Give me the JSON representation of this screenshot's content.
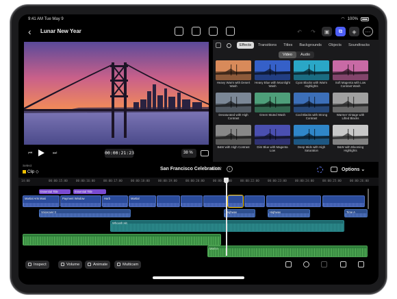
{
  "status": {
    "time": "9:41 AM",
    "date": "Tue May 9",
    "battery": "100%"
  },
  "header": {
    "back_icon": "chevron-left-icon",
    "title": "Lunar New Year"
  },
  "viewer": {
    "timecode": "00:00:21:23",
    "zoom": "38"
  },
  "browser": {
    "tabs": [
      "Effects",
      "Transitions",
      "Titles",
      "Backgrounds",
      "Objects",
      "Soundtracks"
    ],
    "active_tab": "Effects",
    "segments": [
      "Video",
      "Audio"
    ],
    "active_segment": "Video",
    "effects": [
      {
        "name": "Heavy Warm with Desert Wash",
        "tint": "#d88a5a"
      },
      {
        "name": "Heavy Blue with Moonlight Wash",
        "tint": "#3560c8"
      },
      {
        "name": "Cyan Blacks with Warm Highlights",
        "tint": "#2aa7c7"
      },
      {
        "name": "Soft Magenta with Low Contrast Wash",
        "tint": "#c86aa5"
      },
      {
        "name": "Desaturated with High Contrast",
        "tint": "#7b8796"
      },
      {
        "name": "Green Muted Wash",
        "tint": "#4e9f7a"
      },
      {
        "name": "Cool Blacks with Strong Contrast",
        "tint": "#3c6fb8"
      },
      {
        "name": "Warmer Vintage with Lifted Blacks",
        "tint": "#a0a0a0"
      },
      {
        "name": "B&W with High Contrast",
        "tint": "#888888"
      },
      {
        "name": "Dim Blue with Magenta Low",
        "tint": "#4a4fb0"
      },
      {
        "name": "Deep Mids with High Saturation",
        "tint": "#2f86c8"
      },
      {
        "name": "B&W with Blooming Highlights",
        "tint": "#c8c8c8"
      }
    ]
  },
  "timeline": {
    "select_label": "Select",
    "selection": "Clip",
    "project_name": "San Francisco Celebration",
    "duration": "00:32",
    "options_label": "Options",
    "ruler": [
      "14:00",
      "00:00:15:00",
      "00:00:16:00",
      "00:00:17:00",
      "00:00:18:00",
      "00:00:19:00",
      "00:00:20:00",
      "00:00:21:00",
      "00:00:22:00",
      "00:00:23:00",
      "00:00:24:00",
      "00:00:25:00",
      "00:00:26:00"
    ],
    "title_clips": [
      "Essential Title",
      "Essential Title"
    ],
    "video_clips": [
      "Martial Arts Musi",
      "Payment Window",
      "Harb",
      "Martial",
      "",
      "",
      "",
      "",
      "",
      "",
      ""
    ],
    "voiceover_label": "Voiceover 3",
    "highway_labels": [
      "Highway",
      "Highway",
      "Time A"
    ],
    "whoosh_label": "Whoosh Hit",
    "music_label": "Marine"
  },
  "toolbar": {
    "inspect": "Inspect",
    "volume": "Volume",
    "animate": "Animate",
    "multicam": "Multicam"
  }
}
